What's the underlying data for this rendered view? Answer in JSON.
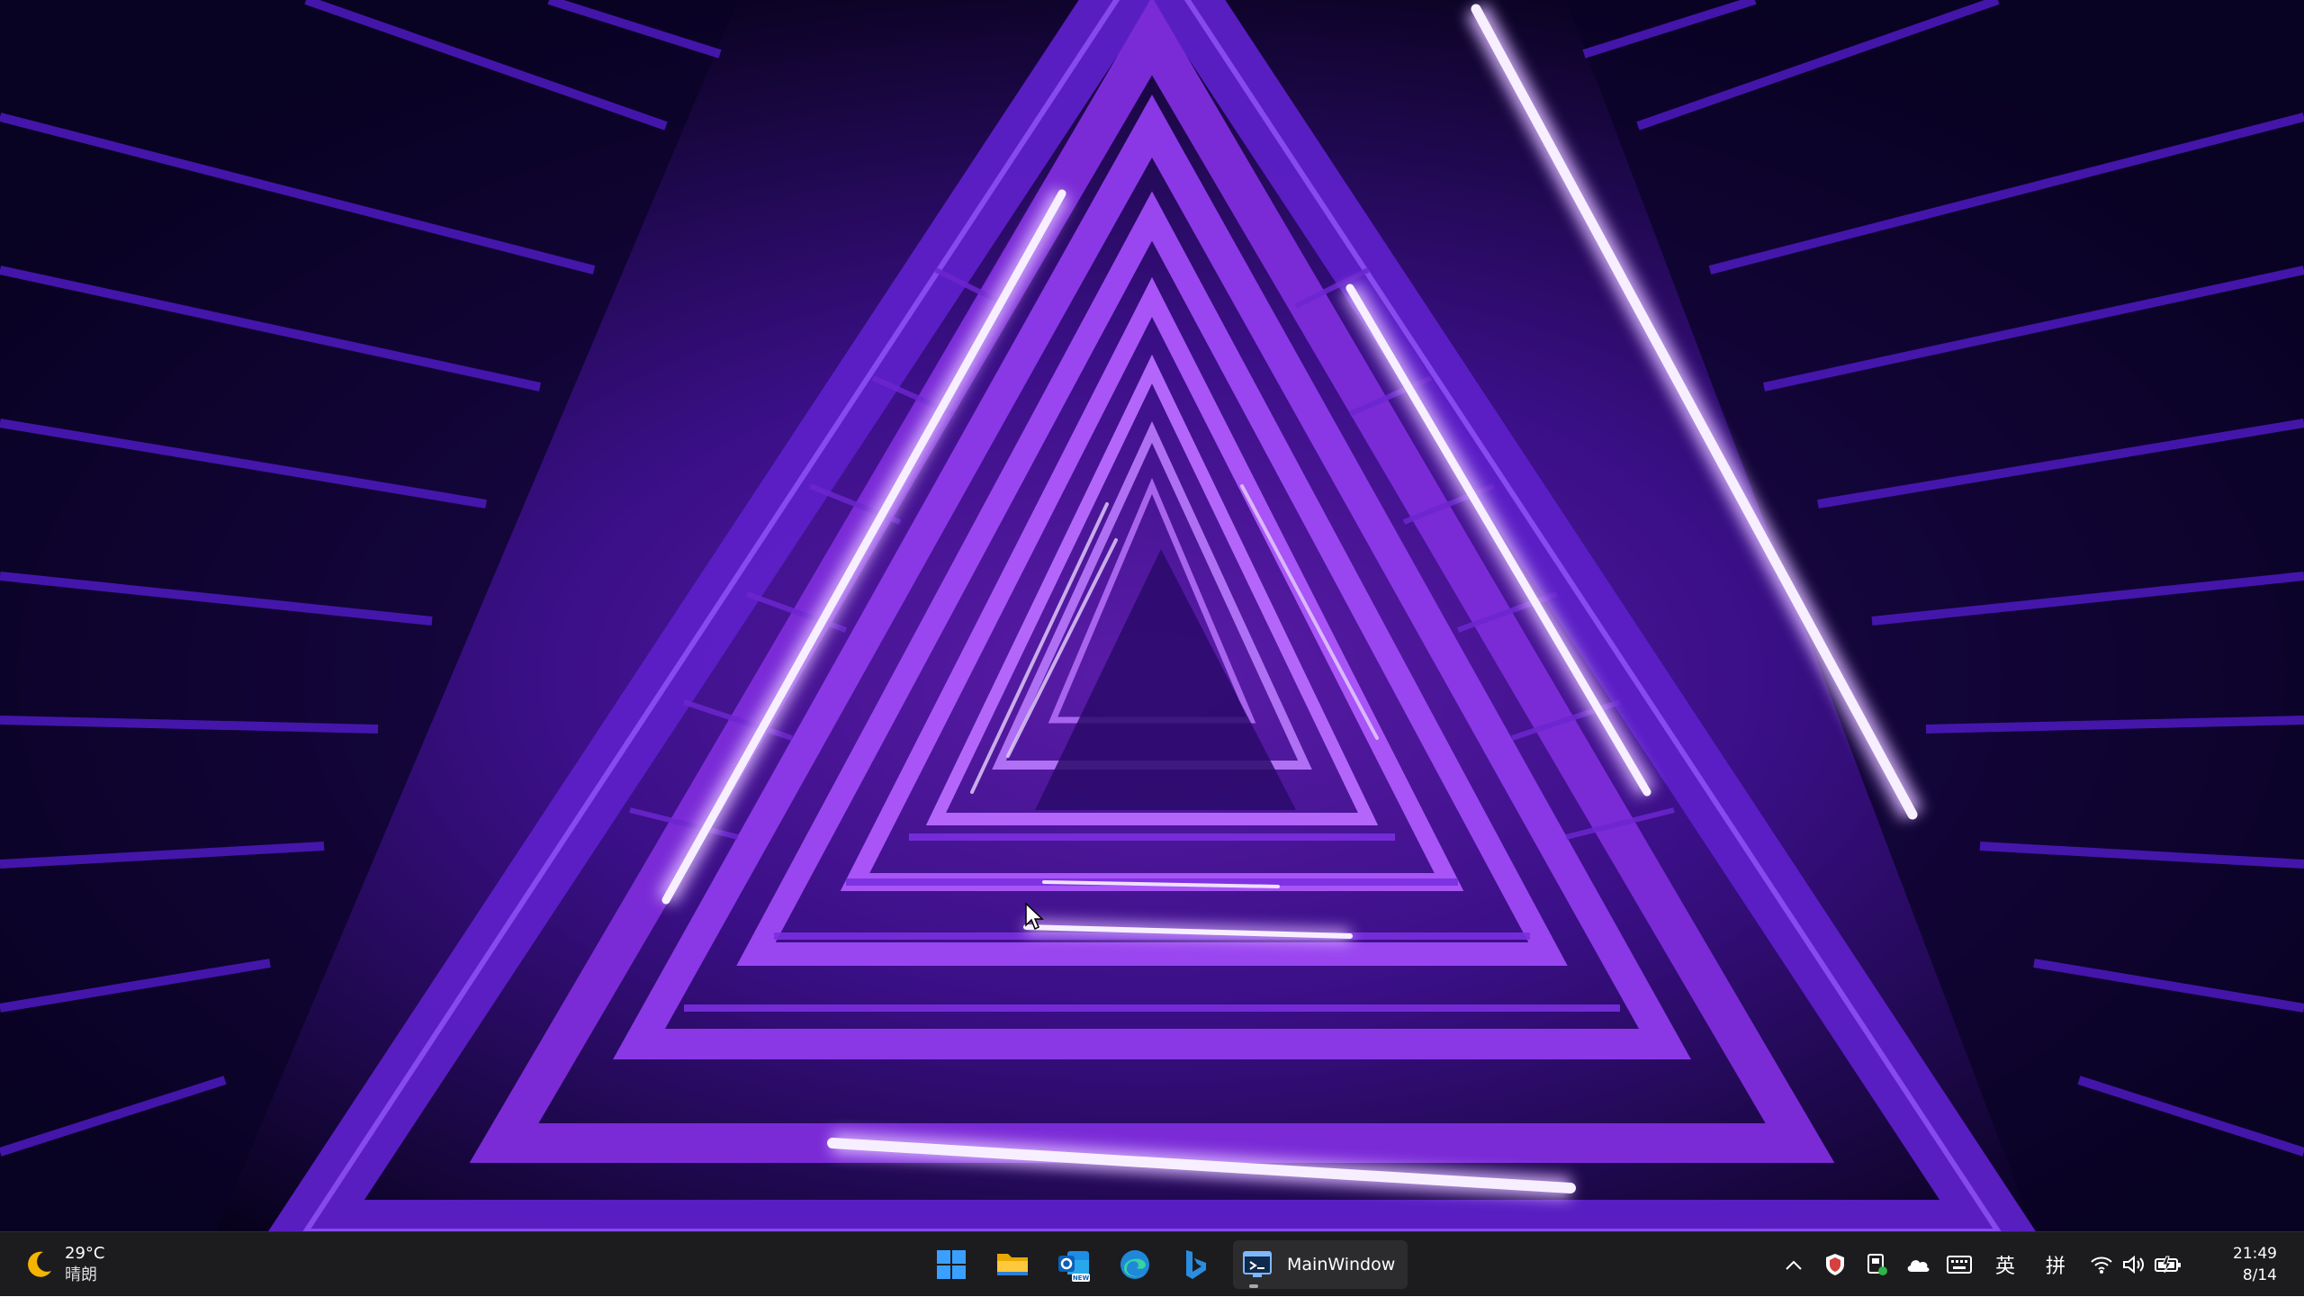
{
  "desktop": {
    "wallpaper": "purple-neon-triangular-staircase",
    "accent_colors": [
      "#7a2bd6",
      "#b872ff",
      "#1a0a52",
      "#f3e6ff"
    ]
  },
  "taskbar": {
    "weather": {
      "icon": "moon-icon",
      "temperature": "29°C",
      "condition": "晴朗"
    },
    "pinned": [
      {
        "name": "start-button",
        "icon": "windows-logo-icon"
      },
      {
        "name": "file-explorer-button",
        "icon": "folder-icon"
      },
      {
        "name": "outlook-new-button",
        "icon": "outlook-icon",
        "badge": "NEW"
      },
      {
        "name": "edge-button",
        "icon": "edge-icon"
      },
      {
        "name": "bing-button",
        "icon": "bing-icon"
      }
    ],
    "running_window": {
      "title": "MainWindow",
      "icon": "app-window-icon"
    },
    "tray": {
      "show_hidden_icon": "chevron-up-icon",
      "icons": [
        "security-shield-icon",
        "device-sync-icon",
        "onedrive-cloud-icon",
        "keyboard-icon"
      ],
      "ime_lang": "英",
      "ime_mode": "拼",
      "quick_icons": [
        "wifi-icon",
        "volume-icon",
        "battery-icon"
      ]
    },
    "clock": {
      "time": "21:49",
      "date": "8/14"
    }
  }
}
